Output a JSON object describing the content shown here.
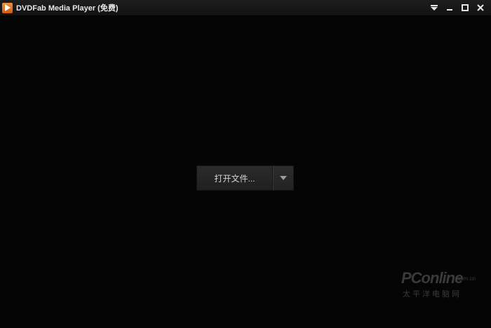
{
  "window": {
    "title": "DVDFab Media Player (免费)"
  },
  "controls": {
    "menu_icon": "menu-down-icon",
    "minimize_icon": "minimize-icon",
    "maximize_icon": "maximize-icon",
    "close_icon": "close-icon"
  },
  "player": {
    "open_file_label": "打开文件...",
    "dropdown_icon": "chevron-down-icon"
  },
  "watermark": {
    "logo": "PConline",
    "domain": ".com.cn",
    "subtitle": "太平洋电脑网"
  },
  "colors": {
    "background": "#050505",
    "titlebar": "#1a1a1a",
    "app_icon": "#e8772a",
    "button": "#262626",
    "text": "#d4d4d4"
  }
}
